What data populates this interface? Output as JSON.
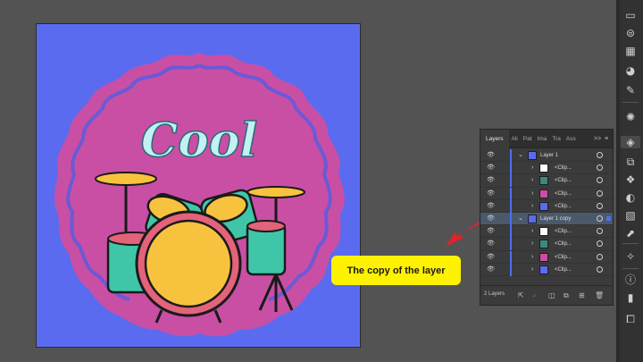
{
  "layers_panel": {
    "tabs": [
      "Layers",
      "Ali",
      "Pat",
      "Ima",
      "Tra",
      "Ass"
    ],
    "more_tabs_icon": ">>",
    "menu_icon": "panel-menu-icon",
    "rows": [
      {
        "name": "Layer 1",
        "type": "layer",
        "expanded": true,
        "thumb_color": "#5B6BEF"
      },
      {
        "name": "<Clip...",
        "type": "sublayer",
        "thumb_color": "#ffffff"
      },
      {
        "name": "<Clip...",
        "type": "sublayer",
        "thumb_color": "#3a8a7a"
      },
      {
        "name": "<Clip...",
        "type": "sublayer",
        "thumb_color": "#c94fa4"
      },
      {
        "name": "<Clip...",
        "type": "sublayer",
        "thumb_color": "#5B6BEF"
      },
      {
        "name": "Layer 1 copy",
        "type": "layer",
        "expanded": true,
        "selected": true,
        "thumb_color": "#5B6BEF"
      },
      {
        "name": "<Clip...",
        "type": "sublayer",
        "thumb_color": "#ffffff"
      },
      {
        "name": "<Clip...",
        "type": "sublayer",
        "thumb_color": "#3a8a7a"
      },
      {
        "name": "<Clip...",
        "type": "sublayer",
        "thumb_color": "#c94fa4"
      },
      {
        "name": "<Clip...",
        "type": "sublayer",
        "thumb_color": "#5B6BEF"
      }
    ],
    "footer": {
      "layer_count": "2 Layers"
    }
  },
  "artboard": {
    "text": "Cool",
    "background": "#5B6BEF",
    "badge_color": "#C94FA4"
  },
  "callout": {
    "text": "The copy of the layer",
    "color": "#FFF200"
  },
  "colors": {
    "app_bg": "#535353",
    "panel_bg": "#3b3b3b",
    "selection_blue": "#4e6ff0",
    "highlight_red": "#e0232a"
  }
}
